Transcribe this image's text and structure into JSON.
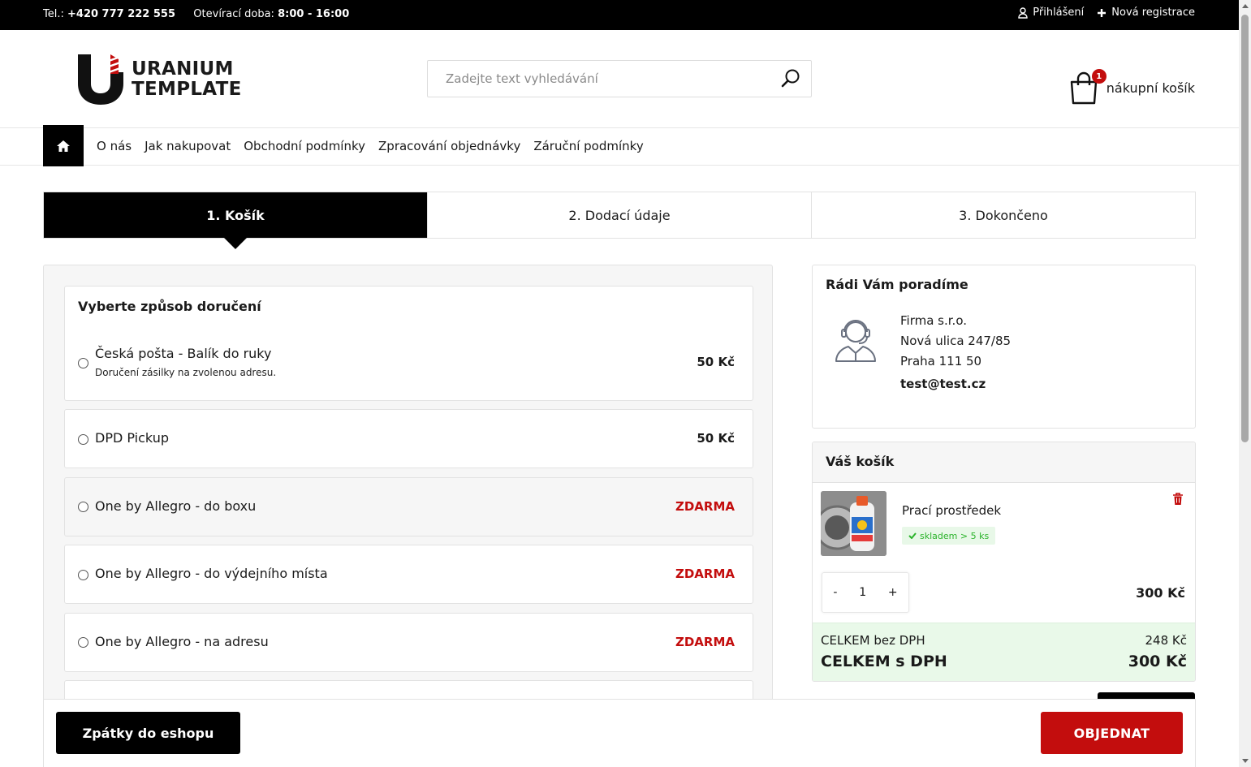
{
  "topbar": {
    "phone_label": "Tel.:",
    "phone": "+420 777 222 555",
    "hours_label": "Otevírací doba:",
    "hours": "8:00 - 16:00",
    "login": "Přihlášení",
    "register": "Nová registrace"
  },
  "header": {
    "logo_line1": "URANIUM",
    "logo_line2": "TEMPLATE",
    "search_placeholder": "Zadejte text vyhledávání",
    "cart_label": "nákupní košík",
    "cart_count": "1"
  },
  "nav": {
    "items": [
      "O nás",
      "Jak nakupovat",
      "Obchodní podmínky",
      "Zpracování objednávky",
      "Záruční podmínky"
    ]
  },
  "steps": [
    "1. Košík",
    "2. Dodací údaje",
    "3. Dokončeno"
  ],
  "delivery": {
    "title": "Vyberte způsob doručení",
    "options": [
      {
        "name": "Česká pošta - Balík do ruky",
        "desc": "Doručení zásilky na zvolenou adresu.",
        "price": "50 Kč"
      },
      {
        "name": "DPD Pickup",
        "price": "50 Kč"
      },
      {
        "name": "One by Allegro - do boxu",
        "price": "ZDARMA"
      },
      {
        "name": "One by Allegro - do výdejního místa",
        "price": "ZDARMA"
      },
      {
        "name": "One by Allegro - na adresu",
        "price": "ZDARMA"
      }
    ]
  },
  "help": {
    "title": "Rádi Vám poradíme",
    "company": "Firma s.r.o.",
    "street": "Nová ulica 247/85",
    "city": "Praha 111 50",
    "email": "test@test.cz"
  },
  "cart": {
    "title": "Váš košík",
    "product_name": "Prací prostředek",
    "stock": "skladem > 5 ks",
    "qty_minus": "-",
    "qty": "1",
    "qty_plus": "+",
    "line_price": "300 Kč",
    "total_excl_label": "CELKEM bez DPH",
    "total_excl": "248 Kč",
    "total_incl_label": "CELKEM s DPH",
    "total_incl": "300 Kč"
  },
  "actions": {
    "back": "Zpátky do eshopu",
    "order": "OBJEDNAT"
  },
  "colors": {
    "accent_red": "#c30d0d",
    "black": "#000000",
    "success_green": "#2bb32b"
  }
}
